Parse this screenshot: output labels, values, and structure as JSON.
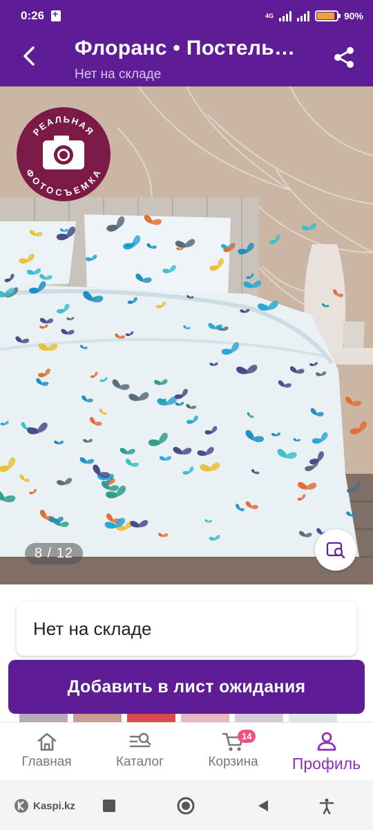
{
  "status_bar": {
    "time": "0:26",
    "network": "4G",
    "battery": "90%",
    "battery_level": 0.9
  },
  "header": {
    "title": "Флоранс • Постель…",
    "subtitle": "Нет на складе"
  },
  "image": {
    "badge_top": "РЕАЛЬНАЯ",
    "badge_bottom": "ФОТОСЪЕМКА",
    "counter": "8 / 12"
  },
  "stock": {
    "label": "Нет на складе"
  },
  "waitlist": {
    "label": "Добавить в лист ожидания"
  },
  "bottom_nav": {
    "items": [
      {
        "label": "Главная",
        "icon": "home-icon"
      },
      {
        "label": "Каталог",
        "icon": "catalog-search-icon"
      },
      {
        "label": "Корзина",
        "icon": "cart-icon",
        "badge": "14"
      },
      {
        "label": "Профиль",
        "icon": "profile-icon",
        "active": true
      }
    ]
  },
  "system_nav": {
    "brand": "Kaspi.kz"
  },
  "colors": {
    "brand": "#5f1d95",
    "active": "#8e2fb8",
    "badge": "#f0507a",
    "photo_badge": "#7a1a45"
  }
}
